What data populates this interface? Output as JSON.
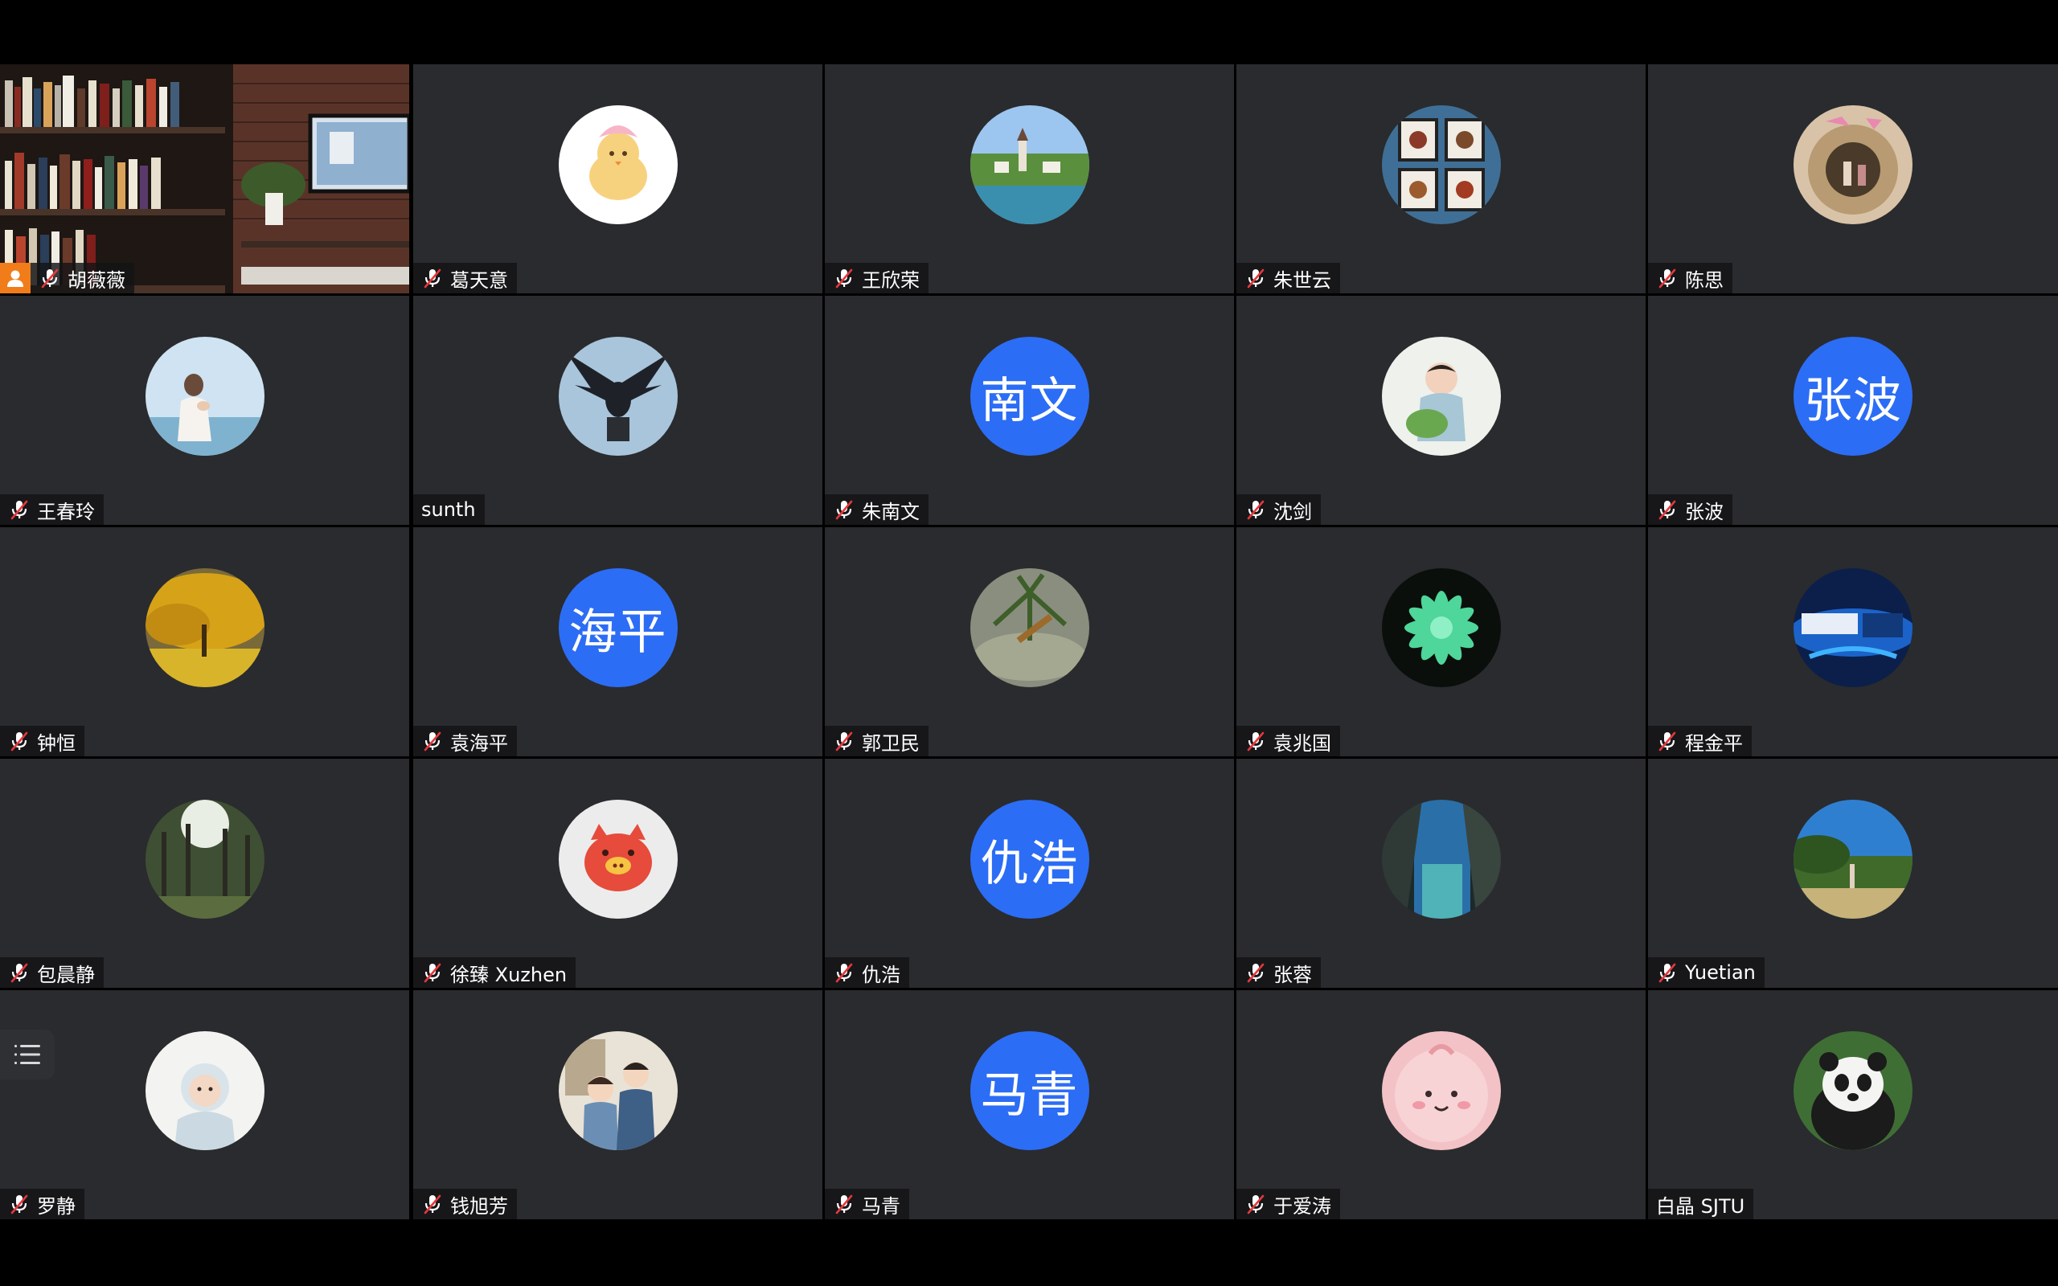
{
  "window": {
    "title": ""
  },
  "participants": [
    {
      "name": "胡薇薇",
      "avatar": "video",
      "muted": true,
      "host": true
    },
    {
      "name": "葛天意",
      "avatar": "photo",
      "photo": "chick-icon",
      "muted": true
    },
    {
      "name": "王欣荣",
      "avatar": "photo",
      "photo": "lakeside-village-photo",
      "muted": true
    },
    {
      "name": "朱世云",
      "avatar": "photo",
      "photo": "framed-flowers-photo",
      "muted": true
    },
    {
      "name": "陈思",
      "avatar": "photo",
      "photo": "arch-sculpture-photo",
      "muted": true
    },
    {
      "name": "王春玲",
      "avatar": "photo",
      "photo": "meditating-woman-photo",
      "muted": true
    },
    {
      "name": "sunth",
      "avatar": "photo",
      "photo": "eagle-statue-photo",
      "muted": false
    },
    {
      "name": "朱南文",
      "avatar": "text",
      "initials": "南文",
      "muted": true
    },
    {
      "name": "沈剑",
      "avatar": "photo",
      "photo": "child-photo",
      "muted": true
    },
    {
      "name": "张波",
      "avatar": "text",
      "initials": "张波",
      "muted": true
    },
    {
      "name": "钟恒",
      "avatar": "photo",
      "photo": "golden-tree-photo",
      "muted": true
    },
    {
      "name": "袁海平",
      "avatar": "text",
      "initials": "海平",
      "muted": true
    },
    {
      "name": "郭卫民",
      "avatar": "photo",
      "photo": "plant-water-photo",
      "muted": true
    },
    {
      "name": "袁兆国",
      "avatar": "photo",
      "photo": "succulent-photo",
      "muted": true
    },
    {
      "name": "程金平",
      "avatar": "photo",
      "photo": "tv-screen-photo",
      "muted": true
    },
    {
      "name": "包晨静",
      "avatar": "photo",
      "photo": "forest-photo",
      "muted": true
    },
    {
      "name": "徐臻 Xuzhen",
      "avatar": "photo",
      "photo": "pig-icon",
      "muted": true
    },
    {
      "name": "仇浩",
      "avatar": "text",
      "initials": "仇浩",
      "muted": true
    },
    {
      "name": "张蓉",
      "avatar": "photo",
      "photo": "waterfall-photo",
      "muted": true
    },
    {
      "name": "Yuetian",
      "avatar": "photo",
      "photo": "landscape-photo",
      "muted": true
    },
    {
      "name": "罗静",
      "avatar": "photo",
      "photo": "baby-photo",
      "muted": true
    },
    {
      "name": "钱旭芳",
      "avatar": "photo",
      "photo": "couple-illustration",
      "muted": true
    },
    {
      "name": "马青",
      "avatar": "text",
      "initials": "马青",
      "muted": true
    },
    {
      "name": "于爱涛",
      "avatar": "photo",
      "photo": "cute-face-icon",
      "muted": true
    },
    {
      "name": "白晶 SJTU",
      "avatar": "photo",
      "photo": "panda-photo",
      "muted": false
    }
  ],
  "icons": {
    "muted_mic": "mic-off-icon",
    "host": "person-icon",
    "side_button": "list-icon"
  },
  "colors": {
    "tile_bg": "#2a2b2e",
    "avatar_blue": "#2c6df5",
    "host_orange": "#f07d19",
    "mute_red": "#e5383b"
  }
}
